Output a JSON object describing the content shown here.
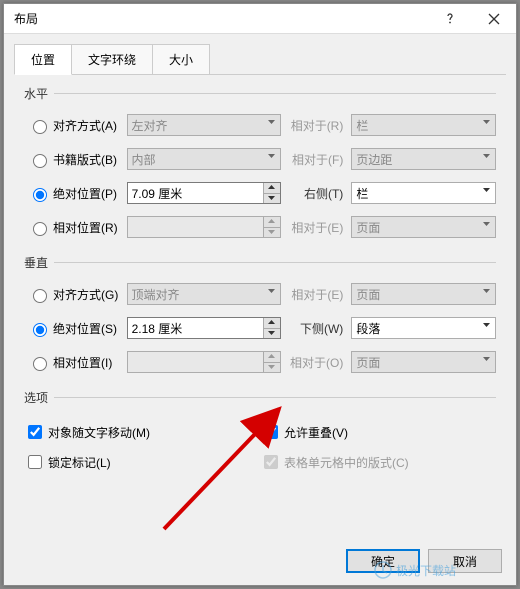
{
  "dialog": {
    "title": "布局"
  },
  "tabs": {
    "t0": "位置",
    "t1": "文字环绕",
    "t2": "大小"
  },
  "h": {
    "heading": "水平",
    "align_label": "对齐方式(A)",
    "align_value": "左对齐",
    "align_rel_label": "相对于(R)",
    "align_rel_value": "栏",
    "book_label": "书籍版式(B)",
    "book_value": "内部",
    "book_rel_label": "相对于(F)",
    "book_rel_value": "页边距",
    "abs_label": "绝对位置(P)",
    "abs_value": "7.09 厘米",
    "abs_rel_label": "右侧(T)",
    "abs_rel_value": "栏",
    "rel_label": "相对位置(R)",
    "rel_value": "",
    "rel_rel_label": "相对于(E)",
    "rel_rel_value": "页面"
  },
  "v": {
    "heading": "垂直",
    "align_label": "对齐方式(G)",
    "align_value": "顶端对齐",
    "align_rel_label": "相对于(E)",
    "align_rel_value": "页面",
    "abs_label": "绝对位置(S)",
    "abs_value": "2.18 厘米",
    "abs_rel_label": "下侧(W)",
    "abs_rel_value": "段落",
    "rel_label": "相对位置(I)",
    "rel_value": "",
    "rel_rel_label": "相对于(O)",
    "rel_rel_value": "页面"
  },
  "opts": {
    "heading": "选项",
    "move_with_text": "对象随文字移动(M)",
    "lock_anchor": "锁定标记(L)",
    "allow_overlap": "允许重叠(V)",
    "layout_in_cell": "表格单元格中的版式(C)"
  },
  "buttons": {
    "ok": "确定",
    "cancel": "取消"
  },
  "watermark": "极光下载站"
}
